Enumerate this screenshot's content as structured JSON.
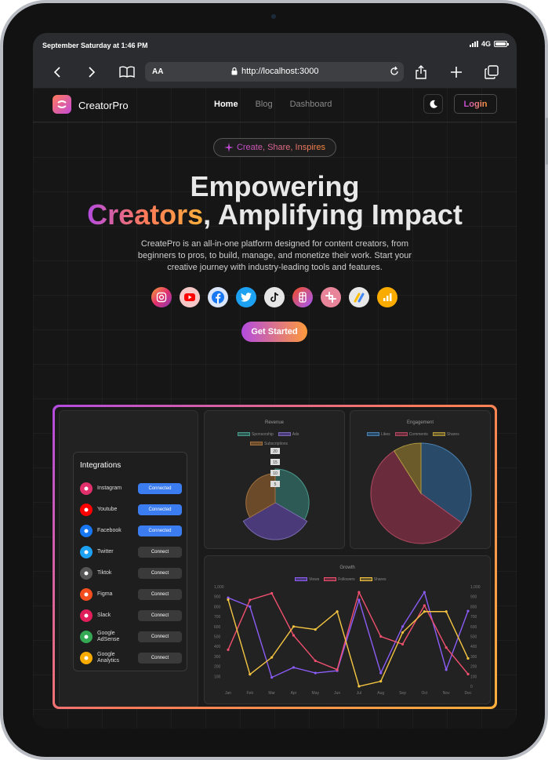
{
  "status": {
    "time": "September Saturday at 1:46 PM",
    "network": "4G"
  },
  "browser": {
    "text_size": "AA",
    "url": "http://localhost:3000"
  },
  "nav": {
    "brand": "CreatorPro",
    "links": [
      "Home",
      "Blog",
      "Dashboard"
    ],
    "active": "Home",
    "login": "Login"
  },
  "hero": {
    "badge": "Create, Share, Inspires",
    "title_line1": "Empowering",
    "title_highlight": "Creators",
    "title_rest": ", Amplifying Impact",
    "description": "CreatePro is an all-in-one platform designed for content creators, from beginners to pros, to build, manage, and monetize their work. Start your creative journey with industry-leading tools and features.",
    "cta": "Get Started"
  },
  "social_icons": [
    "instagram-icon",
    "youtube-icon",
    "facebook-icon",
    "twitter-icon",
    "tiktok-icon",
    "figma-icon",
    "slack-icon",
    "google-adsense-icon",
    "google-analytics-icon"
  ],
  "integrations": {
    "title": "Integrations",
    "items": [
      {
        "name": "Instagram",
        "action": "Connected",
        "connected": true,
        "color": "#e1306c"
      },
      {
        "name": "Youtube",
        "action": "Connected",
        "connected": true,
        "color": "#ff0000"
      },
      {
        "name": "Facebook",
        "action": "Connected",
        "connected": true,
        "color": "#1877f2"
      },
      {
        "name": "Twitter",
        "action": "Connect",
        "connected": false,
        "color": "#1da1f2"
      },
      {
        "name": "Tiktok",
        "action": "Connect",
        "connected": false,
        "color": "#555555"
      },
      {
        "name": "Figma",
        "action": "Connect",
        "connected": false,
        "color": "#f24e1e"
      },
      {
        "name": "Slack",
        "action": "Connect",
        "connected": false,
        "color": "#e01e5a"
      },
      {
        "name": "Google AdSense",
        "action": "Connect",
        "connected": false,
        "color": "#34a853"
      },
      {
        "name": "Google Analytics",
        "action": "Connect",
        "connected": false,
        "color": "#f9ab00"
      }
    ]
  },
  "chart_data": [
    {
      "type": "pie",
      "title": "Revenue",
      "labels": [
        "Sponsorship",
        "Ads",
        "Subscriptions"
      ],
      "values": [
        25,
        40,
        20
      ],
      "radial_ticks": [
        "20",
        "15",
        "10",
        "5"
      ],
      "colors": [
        "#2e5a56",
        "#4a3a7a",
        "#6b4a2a"
      ]
    },
    {
      "type": "pie",
      "title": "Engagement",
      "labels": [
        "Likes",
        "Comments",
        "Shares"
      ],
      "values": [
        35,
        56,
        9
      ],
      "colors": [
        "#2a4a6a",
        "#6a2c3c",
        "#6b5a2a"
      ]
    },
    {
      "type": "line",
      "title": "Growth",
      "categories": [
        "Jan",
        "Feb",
        "Mar",
        "Apr",
        "May",
        "Jun",
        "Jul",
        "Aug",
        "Sep",
        "Oct",
        "Nov",
        "Dec"
      ],
      "y_ticks_left": [
        "1,000",
        "900",
        "800",
        "700",
        "600",
        "500",
        "400",
        "300",
        "200",
        "100"
      ],
      "y_ticks_right": [
        "1,000",
        "900",
        "800",
        "700",
        "600",
        "500",
        "400",
        "300",
        "200",
        "100",
        "0"
      ],
      "ylim": [
        100,
        1000
      ],
      "y2lim": [
        0,
        1000
      ],
      "series": [
        {
          "name": "Views",
          "color": "#8b5cf6",
          "axis": "left",
          "values": [
            900,
            820,
            180,
            270,
            220,
            240,
            880,
            220,
            640,
            950,
            250,
            780
          ]
        },
        {
          "name": "Followers",
          "color": "#f0506e",
          "axis": "left",
          "values": [
            430,
            880,
            940,
            560,
            330,
            250,
            950,
            550,
            480,
            830,
            450,
            210
          ]
        },
        {
          "name": "Shares",
          "color": "#f5c542",
          "axis": "right",
          "values": [
            870,
            120,
            290,
            600,
            570,
            750,
            0,
            50,
            540,
            750,
            750,
            280
          ]
        }
      ]
    }
  ]
}
